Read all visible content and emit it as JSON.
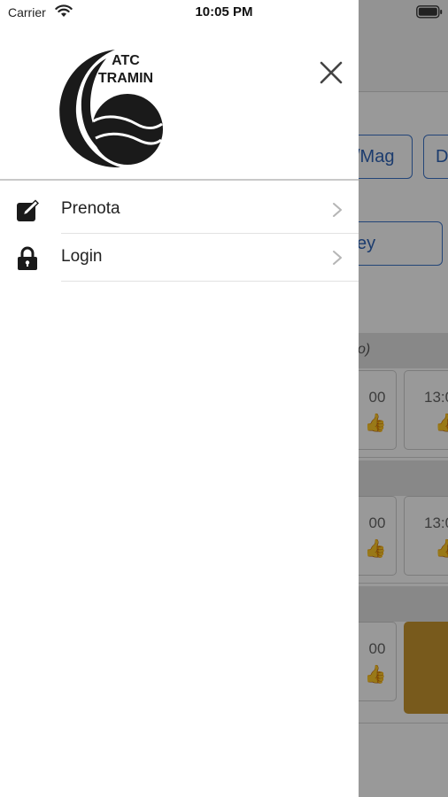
{
  "status_bar": {
    "carrier": "Carrier",
    "time": "10:05 PM"
  },
  "drawer": {
    "logo_text": {
      "line1": "ATC",
      "line2": "TRAMIN"
    },
    "close_icon": "close-icon",
    "menu": [
      {
        "label": "Prenota",
        "icon": "edit-icon"
      },
      {
        "label": "Login",
        "icon": "lock-icon"
      }
    ]
  },
  "background": {
    "chips": [
      "/Mag",
      "D",
      "ey"
    ],
    "section_text": "o)",
    "slots_row1": [
      "00",
      "13:0"
    ],
    "slots_row2": [
      "00",
      "13:0"
    ],
    "slots_row3": [
      "00"
    ],
    "colors": {
      "accent_blue": "#3b73c9",
      "available_green": "#2e9e4e",
      "booked_gold": "#c9962f"
    }
  }
}
